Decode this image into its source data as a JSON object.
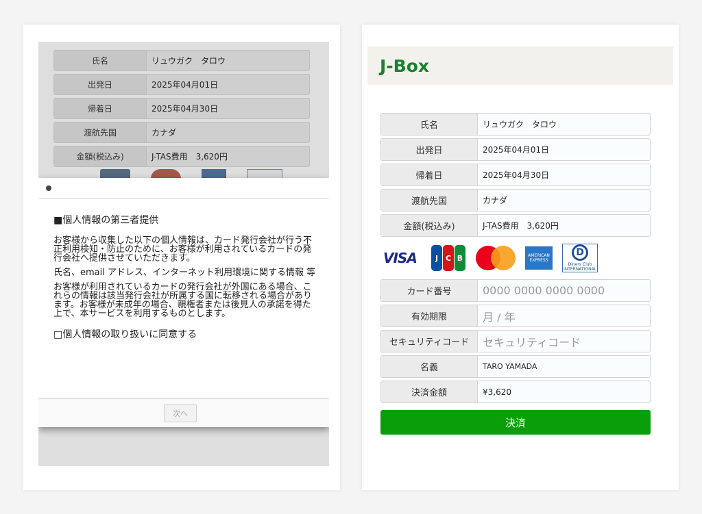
{
  "info_rows": [
    {
      "label": "氏名",
      "value": "リュウガク　タロウ"
    },
    {
      "label": "出発日",
      "value": "2025年04月01日"
    },
    {
      "label": "帰着日",
      "value": "2025年04月30日"
    },
    {
      "label": "渡航先国",
      "value": "カナダ"
    },
    {
      "label": "金額(税込み)",
      "value": "J-TAS費用　3,620円"
    }
  ],
  "modal": {
    "heading": "■個人情報の第三者提供",
    "paragraphs": [
      "お客様から収集した以下の個人情報は、カード発行会社が行う不正利用検知・防止のために、お客様が利用されているカードの発行会社へ提供させていただきます。",
      "氏名、email アドレス、インターネット利用環境に関する情報 等",
      "お客様が利用されているカードの発行会社が外国にある場合、これらの情報は該当発行会社が所属する国に転移される場合があります。お客様が未成年の場合、親権者または後見人の承諾を得た上で、本サービスを利用するものとします。"
    ],
    "consent_label": "□個人情報の取り扱いに同意する",
    "next_label": "次へ"
  },
  "jbox": {
    "title": "J-Box"
  },
  "card_brands": {
    "visa": "VISA",
    "jcb": [
      "J",
      "C",
      "B"
    ],
    "amex": [
      "AMERICAN",
      "EXPRESS"
    ],
    "diners": [
      "Diners Club",
      "INTERNATIONAL"
    ]
  },
  "payment_fields": [
    {
      "label": "カード番号",
      "placeholder": "0000 0000 0000 0000"
    },
    {
      "label": "有効期限",
      "placeholder": "月 / 年"
    },
    {
      "label": "セキュリティコード",
      "placeholder": "セキュリティコード"
    },
    {
      "label": "名義",
      "value": "TARO YAMADA"
    },
    {
      "label": "決済金額",
      "value": "¥3,620"
    }
  ],
  "pay_button_label": "決済",
  "colors": {
    "brand_green": "#1c8031",
    "pay_green": "#0a9e0a"
  }
}
